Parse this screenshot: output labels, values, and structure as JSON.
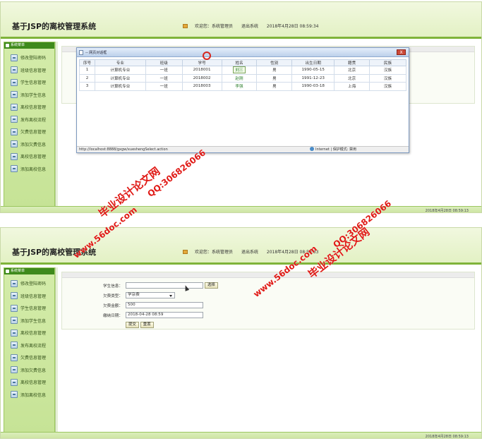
{
  "screenshots": [
    {
      "app_title": "基于JSP的离校管理系统",
      "header": {
        "welcome": "欢迎您：系统管理员",
        "logout": "退出系统",
        "datetime": "2018年4月28日 08:59:34"
      },
      "sidebar": {
        "title": "系统菜单",
        "items": [
          "修改登陆密码",
          "班级信息管理",
          "学生信息管理",
          "添加学生信息",
          "离校信息管理",
          "发布离校流程",
          "欠费信息管理",
          "添加欠费信息",
          "离校信息管理",
          "添加离校信息"
        ]
      },
      "dialog": {
        "title": "-- 网页对话框",
        "close": "X",
        "columns": [
          "序号",
          "专业",
          "班级",
          "学号",
          "姓名",
          "性别",
          "出生日期",
          "籍贯",
          "民族"
        ],
        "rows": [
          [
            "1",
            "计算机专业",
            "一班",
            "2018001",
            "刘三",
            "男",
            "1990-05-15",
            "北京",
            "汉族"
          ],
          [
            "2",
            "计算机专业",
            "一班",
            "2018002",
            "赵刚",
            "男",
            "1991-12-23",
            "北京",
            "汉族"
          ],
          [
            "3",
            "计算机专业",
            "一班",
            "2018003",
            "李强",
            "男",
            "1990-03-18",
            "上海",
            "汉族"
          ]
        ],
        "status_url": "http://localhost:8888/gxgw/xueshengSelect.action",
        "status_zone": "Internet | 保护模式: 禁用"
      },
      "statusbar_time": "2018年4月28日 08:59:13"
    },
    {
      "app_title": "基于JSP的离校管理系统",
      "header": {
        "welcome": "欢迎您：系统管理员",
        "logout": "退出系统",
        "datetime": "2018年4月28日 08:59:33"
      },
      "sidebar": {
        "title": "系统菜单",
        "items": [
          "修改登陆密码",
          "班级信息管理",
          "学生信息管理",
          "添加学生信息",
          "离校信息管理",
          "发布离校流程",
          "欠费信息管理",
          "添加欠费信息",
          "离校信息管理",
          "添加离校信息"
        ]
      },
      "form": {
        "student_label": "学生信息：",
        "student_value": "",
        "select_button": "选择",
        "fee_type_label": "欠费类型：",
        "fee_type_value": "学杂费",
        "amount_label": "欠费金额：",
        "amount_value": "500",
        "date_label": "缴纳日期：",
        "date_value": "2018-04-28 08:59",
        "submit": "提交",
        "reset": "重置"
      },
      "statusbar_time": "2018年4月28日 08:59:13"
    }
  ],
  "watermarks": [
    "毕业设计论文网",
    "www.56doc.com",
    "QQ:306826066",
    "www.56doc.com",
    "QQ:306826066",
    "毕业设计论文网"
  ],
  "colors": {
    "header_border": "#7fb43a",
    "sidebar_bg": "#c6e396",
    "watermark": "#e01a16"
  }
}
